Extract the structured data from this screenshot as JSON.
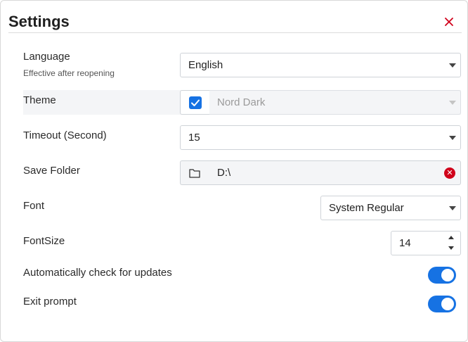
{
  "dialog": {
    "title": "Settings",
    "close_icon": "close-icon",
    "close_color": "#d0021b"
  },
  "settings": {
    "language": {
      "label": "Language",
      "sublabel": "Effective after reopening",
      "value": "English"
    },
    "theme": {
      "label": "Theme",
      "checked": true,
      "value": "Nord Dark"
    },
    "timeout": {
      "label": "Timeout (Second)",
      "value": "15"
    },
    "save_folder": {
      "label": "Save Folder",
      "value": "D:\\",
      "icon": "folder-icon",
      "clear_icon": "clear-icon",
      "clear_glyph": "✕"
    },
    "font": {
      "label": "Font",
      "value": "System Regular"
    },
    "font_size": {
      "label": "FontSize",
      "value": "14"
    },
    "auto_update": {
      "label": "Automatically check for updates",
      "enabled": true
    },
    "exit_prompt": {
      "label": "Exit prompt",
      "enabled": true
    }
  },
  "colors": {
    "accent": "#1672e3",
    "danger": "#d0021b"
  }
}
